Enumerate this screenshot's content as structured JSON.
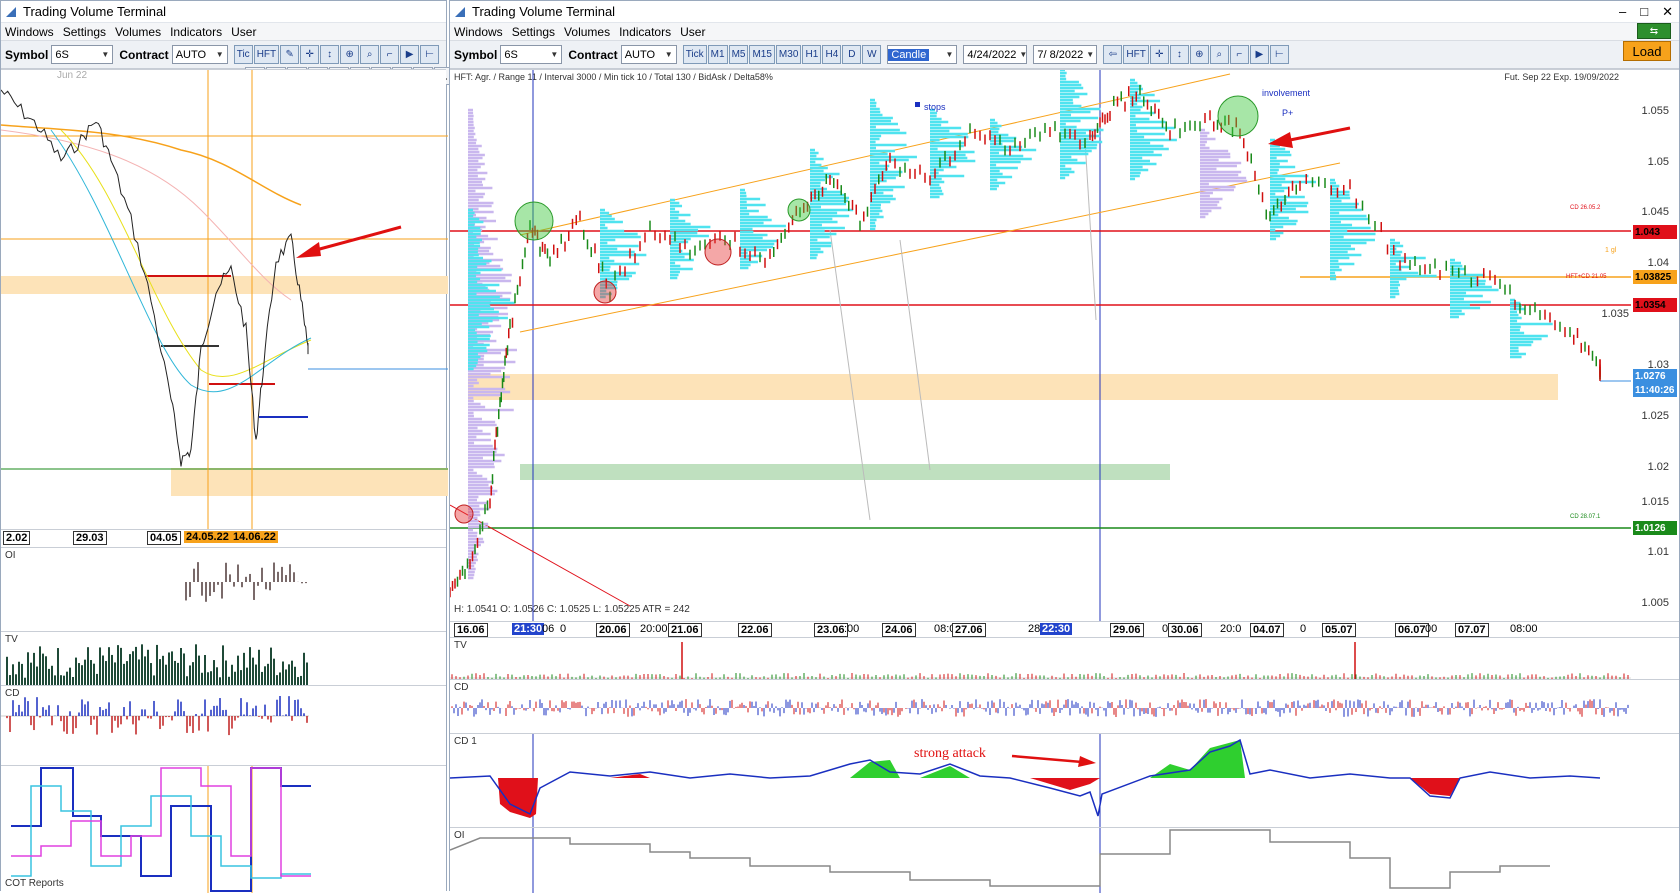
{
  "left": {
    "title": "Trading Volume Terminal",
    "menu": [
      "Windows",
      "Settings",
      "Volumes",
      "Indicators",
      "User"
    ],
    "toolbar": {
      "symbol_label": "Symbol",
      "symbol_value": "6S",
      "contract_label": "Contract",
      "contract_value": "AUTO",
      "tick_btn": "Tic",
      "hft_btn": "HFT"
    },
    "contract_month": "Jun 22",
    "x_labels": [
      "2.02",
      "29.03",
      "04.05",
      "24.05.22",
      "14.06.22"
    ],
    "panels": {
      "oi": "OI",
      "tv": "TV",
      "cd": "CD",
      "cot": "COT Reports"
    }
  },
  "right": {
    "title": "Trading Volume Terminal",
    "menu": [
      "Windows",
      "Settings",
      "Volumes",
      "Indicators",
      "User"
    ],
    "toolbar": {
      "symbol_label": "Symbol",
      "symbol_value": "6S",
      "contract_label": "Contract",
      "contract_value": "AUTO",
      "timeframes": [
        "Tick",
        "M1",
        "M5",
        "M15",
        "M30",
        "H1",
        "H4",
        "D",
        "W"
      ],
      "chart_type": "Candle",
      "date_from": "4/24/2022",
      "date_to": "7/ 8/2022",
      "hft_btn": "HFT",
      "load_btn": "Load"
    },
    "chart": {
      "info": "HFT: Agr. / Range 11 / Interval 3000 / Min tick 10 / Total 130 / BidAsk / Delta58%",
      "contract_info": "Fut. Sep 22 Exp. 19/09/2022",
      "ohlc": "H: 1.0541   O: 1.0526   C: 1.0525   L: 1.05225   ATR = 242",
      "annotations": {
        "stops": "stops",
        "involvement": "involvement",
        "p_plus": "P+"
      },
      "y_ticks": [
        "1.055",
        "1.05",
        "1.045",
        "1.04",
        "1.035",
        "1.03",
        "1.025",
        "1.02",
        "1.015",
        "1.01",
        "1.005"
      ],
      "price_labels": [
        {
          "text": "1.043",
          "color": "#e0101a"
        },
        {
          "text": "1.03825",
          "color": "#f7a21b"
        },
        {
          "text": "1.0354",
          "color": "#e0101a"
        },
        {
          "text": "1.0276",
          "color": "#3b8fe0"
        },
        {
          "text": "11:40:26",
          "color": "#3b8fe0"
        },
        {
          "text": "1.0126",
          "color": "#1a8a1a"
        }
      ],
      "small_labels": {
        "cd1": "CD 26.05.2",
        "gl": "1 gl",
        "hft": "HFT+CD 21.05",
        "cd2": "CD 28.07.1"
      },
      "x_labels": [
        {
          "t": "16.06",
          "s": "box"
        },
        {
          "t": "21:30",
          "s": "hl"
        },
        {
          "t": "06",
          "s": ""
        },
        {
          "t": "0",
          "s": ""
        },
        {
          "t": "20.06",
          "s": "box"
        },
        {
          "t": "20:00",
          "s": ""
        },
        {
          "t": "21.06",
          "s": "box"
        },
        {
          "t": "22.06",
          "s": "box"
        },
        {
          "t": "23.06",
          "s": "box"
        },
        {
          "t": ":00",
          "s": ""
        },
        {
          "t": "24.06",
          "s": "box"
        },
        {
          "t": "08:0",
          "s": ""
        },
        {
          "t": "27.06",
          "s": "box"
        },
        {
          "t": "28",
          "s": ""
        },
        {
          "t": "22:30",
          "s": "hl"
        },
        {
          "t": "29.06",
          "s": "box"
        },
        {
          "t": "08:00",
          "s": ""
        },
        {
          "t": "30.06",
          "s": "box"
        },
        {
          "t": "20:0",
          "s": ""
        },
        {
          "t": "04.07",
          "s": "box"
        },
        {
          "t": "0",
          "s": ""
        },
        {
          "t": "05.07",
          "s": "box"
        },
        {
          "t": "06.07",
          "s": "box"
        },
        {
          "t": "00",
          "s": ""
        },
        {
          "t": "07.07",
          "s": "box"
        },
        {
          "t": "08:00",
          "s": ""
        }
      ]
    },
    "panels": {
      "tv": "TV",
      "cd": "CD",
      "cd1": "CD 1",
      "oi": "OI"
    },
    "strong_attack": "strong attack"
  }
}
